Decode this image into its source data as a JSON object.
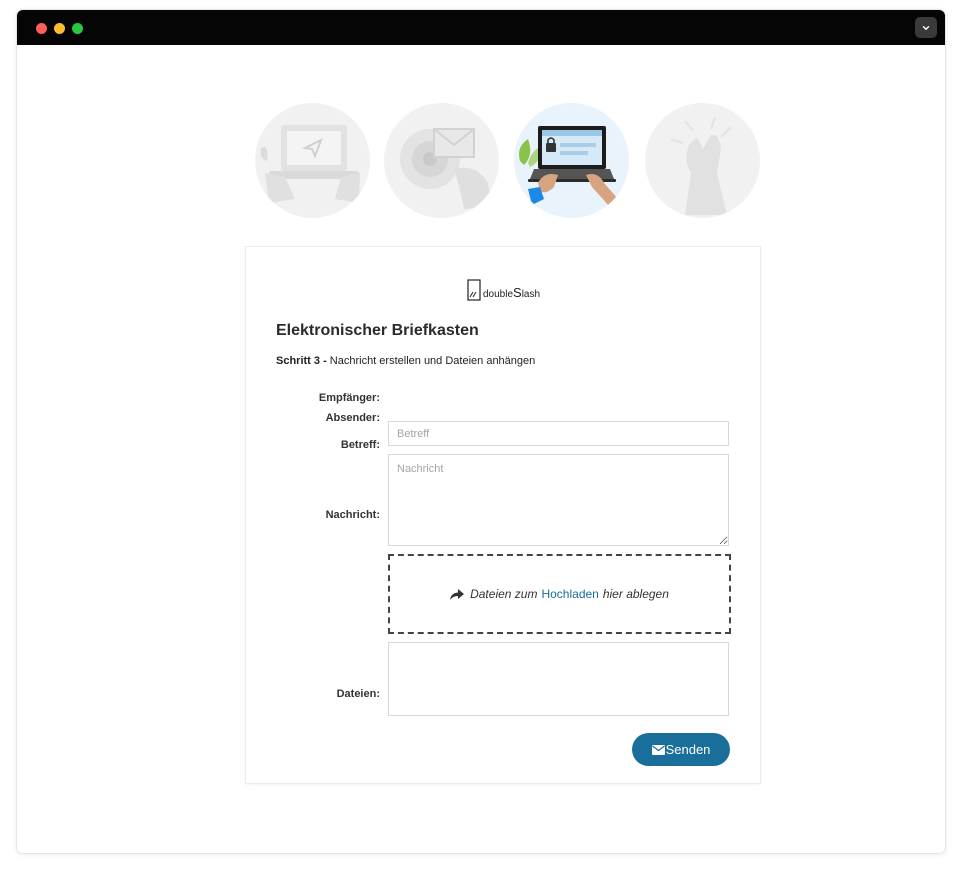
{
  "window": {
    "controls": [
      "close",
      "minimize",
      "maximize"
    ],
    "menu_icon": "chevron-down-icon"
  },
  "steps": [
    {
      "id": 1,
      "icon": "laptop-send-icon",
      "state": "done"
    },
    {
      "id": 2,
      "icon": "mail-open-icon",
      "state": "done"
    },
    {
      "id": 3,
      "icon": "laptop-lock-icon",
      "state": "active"
    },
    {
      "id": 4,
      "icon": "high-five-icon",
      "state": "upcoming"
    }
  ],
  "form": {
    "logo": {
      "prefix": "double",
      "suffix_big": "S",
      "suffix": "lash"
    },
    "title": "Elektronischer Briefkasten",
    "step_strong": "Schritt 3 -",
    "step_text": " Nachricht erstellen und Dateien anhängen",
    "labels": {
      "recipient": "Empfänger:",
      "sender": "Absender:",
      "subject": "Betreff:",
      "message": "Nachricht:",
      "files": "Dateien:"
    },
    "subject_placeholder": "Betreff",
    "message_placeholder": "Nachricht",
    "dropzone": {
      "before": "Dateien zum",
      "link": "Hochladen",
      "after": "hier ablegen"
    },
    "send_label": "Senden",
    "accent_color": "#1a6e9a"
  }
}
